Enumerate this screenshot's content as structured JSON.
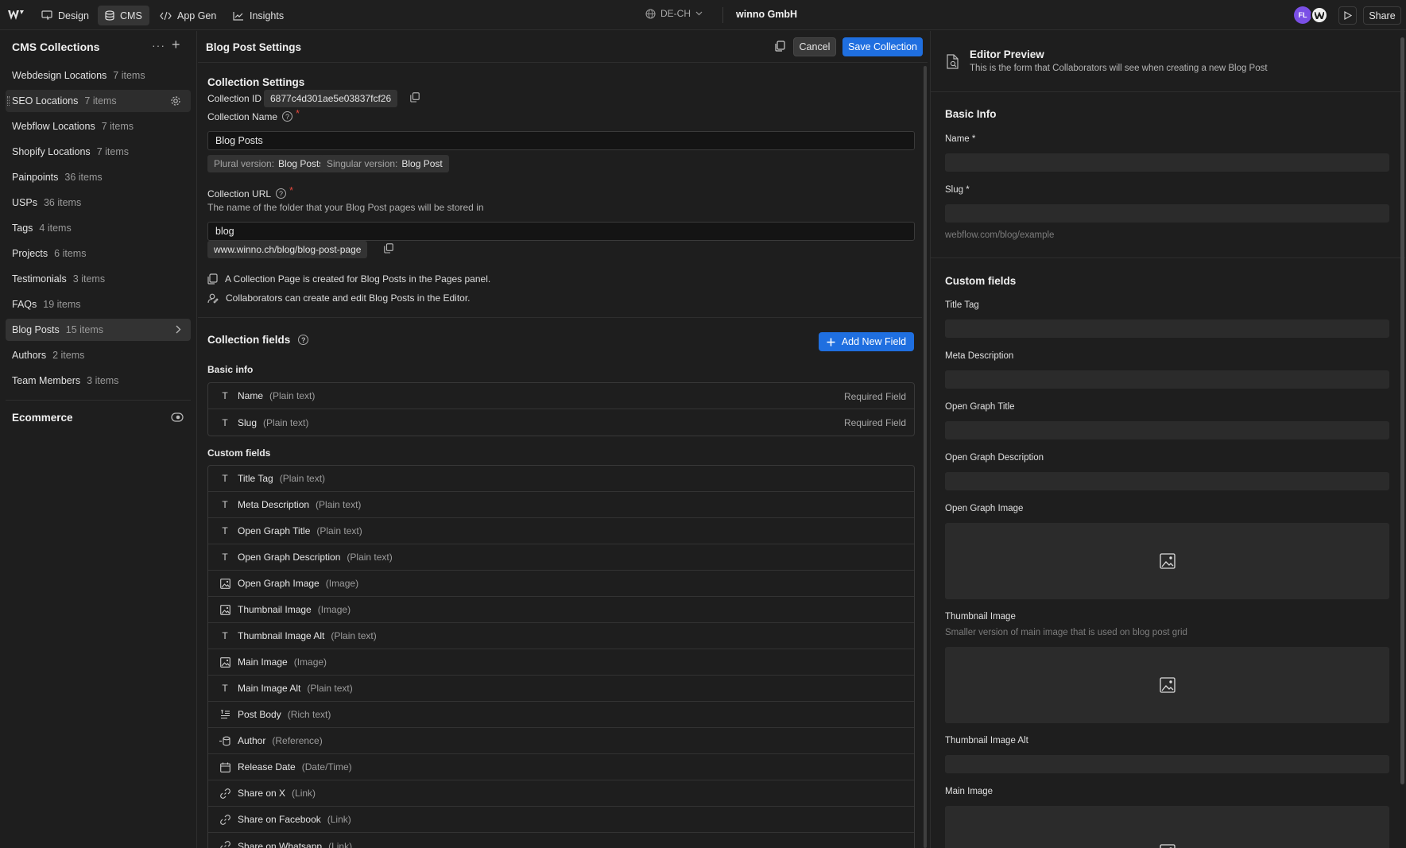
{
  "topbar": {
    "tabs": [
      {
        "label": "Design",
        "icon": "design-icon"
      },
      {
        "label": "CMS",
        "icon": "database-icon"
      },
      {
        "label": "App Gen",
        "icon": "code-icon"
      },
      {
        "label": "Insights",
        "icon": "chart-icon"
      }
    ],
    "locale": "DE-CH",
    "site_name": "winno GmbH",
    "avatar_initials": "FL",
    "share_label": "Share"
  },
  "sidebar": {
    "title": "CMS Collections",
    "collections": [
      {
        "name": "Webdesign Locations",
        "count": "7 items"
      },
      {
        "name": "SEO Locations",
        "count": "7 items"
      },
      {
        "name": "Webflow Locations",
        "count": "7 items"
      },
      {
        "name": "Shopify Locations",
        "count": "7 items"
      },
      {
        "name": "Painpoints",
        "count": "36 items"
      },
      {
        "name": "USPs",
        "count": "36 items"
      },
      {
        "name": "Tags",
        "count": "4 items"
      },
      {
        "name": "Projects",
        "count": "6 items"
      },
      {
        "name": "Testimonials",
        "count": "3 items"
      },
      {
        "name": "FAQs",
        "count": "19 items"
      },
      {
        "name": "Blog Posts",
        "count": "15 items"
      },
      {
        "name": "Authors",
        "count": "2 items"
      },
      {
        "name": "Team Members",
        "count": "3 items"
      }
    ],
    "ecommerce_label": "Ecommerce"
  },
  "settings": {
    "header_title": "Blog Post Settings",
    "cancel_label": "Cancel",
    "save_label": "Save Collection",
    "section_title": "Collection Settings",
    "collection_id_label": "Collection ID",
    "collection_id": "6877c4d301ae5e03837fcf26",
    "collection_name_label": "Collection Name",
    "collection_name": "Blog Posts",
    "plural_key": "Plural version:",
    "plural_value": "Blog Posts",
    "singular_key": "Singular version:",
    "singular_value": "Blog Post",
    "url_label": "Collection URL",
    "url_hint": "The name of the folder that your Blog Post pages will be stored in",
    "url_value": "blog",
    "url_preview": "www.winno.ch/blog/blog-post-page",
    "info_page": "A Collection Page is created for Blog Posts in the Pages panel.",
    "info_editor": "Collaborators can create and edit Blog Posts in the Editor."
  },
  "fields": {
    "title": "Collection fields",
    "add_label": "Add New Field",
    "basic_label": "Basic info",
    "basic": [
      {
        "name": "Name",
        "type": "(Plain text)",
        "required": "Required Field",
        "icon": "text-icon"
      },
      {
        "name": "Slug",
        "type": "(Plain text)",
        "required": "Required Field",
        "icon": "text-icon"
      }
    ],
    "custom_label": "Custom fields",
    "custom": [
      {
        "name": "Title Tag",
        "type": "(Plain text)",
        "icon": "text-icon"
      },
      {
        "name": "Meta Description",
        "type": "(Plain text)",
        "icon": "text-icon"
      },
      {
        "name": "Open Graph Title",
        "type": "(Plain text)",
        "icon": "text-icon"
      },
      {
        "name": "Open Graph Description",
        "type": "(Plain text)",
        "icon": "text-icon"
      },
      {
        "name": "Open Graph Image",
        "type": "(Image)",
        "icon": "image-icon"
      },
      {
        "name": "Thumbnail Image",
        "type": "(Image)",
        "icon": "image-icon"
      },
      {
        "name": "Thumbnail Image Alt",
        "type": "(Plain text)",
        "icon": "text-icon"
      },
      {
        "name": "Main Image",
        "type": "(Image)",
        "icon": "image-icon"
      },
      {
        "name": "Main Image Alt",
        "type": "(Plain text)",
        "icon": "text-icon"
      },
      {
        "name": "Post Body",
        "type": "(Rich text)",
        "icon": "rich-text-icon"
      },
      {
        "name": "Author",
        "type": "(Reference)",
        "icon": "reference-icon"
      },
      {
        "name": "Release Date",
        "type": "(Date/Time)",
        "icon": "calendar-icon"
      },
      {
        "name": "Share on X",
        "type": "(Link)",
        "icon": "link-icon"
      },
      {
        "name": "Share on Facebook",
        "type": "(Link)",
        "icon": "link-icon"
      },
      {
        "name": "Share on Whatsapp",
        "type": "(Link)",
        "icon": "link-icon"
      }
    ]
  },
  "preview": {
    "title": "Editor Preview",
    "description": "This is the form that Collaborators will see when creating a new Blog Post",
    "basic_title": "Basic Info",
    "name_label": "Name *",
    "slug_label": "Slug *",
    "slug_hint": "webflow.com/blog/example",
    "custom_title": "Custom fields",
    "title_tag": "Title Tag",
    "meta_description": "Meta Description",
    "og_title": "Open Graph Title",
    "og_description": "Open Graph Description",
    "og_image": "Open Graph Image",
    "thumbnail_image": "Thumbnail Image",
    "thumbnail_hint": "Smaller version of main image that is used on blog post grid",
    "thumbnail_alt": "Thumbnail Image Alt",
    "main_image": "Main Image"
  }
}
